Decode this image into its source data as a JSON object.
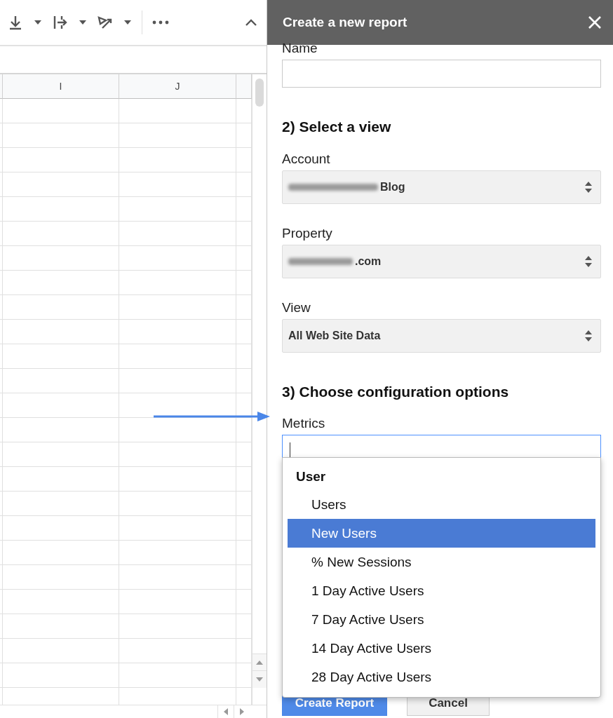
{
  "sheet": {
    "columns": [
      "I",
      "J"
    ]
  },
  "panel": {
    "title": "Create a new report",
    "name_field": {
      "label": "Name"
    },
    "view_section": {
      "heading": "2) Select a view",
      "selects": [
        {
          "label": "Account",
          "value": "Blog",
          "redacted": true
        },
        {
          "label": "Property",
          "value": ".com",
          "redacted": true
        },
        {
          "label": "View",
          "value": "All Web Site Data",
          "redacted": false
        }
      ]
    },
    "config_section": {
      "heading": "3) Choose configuration options",
      "metrics": {
        "label": "Metrics",
        "focused": true,
        "dropdown": {
          "group": "User",
          "options": [
            {
              "label": "Users",
              "selected": false
            },
            {
              "label": "New Users",
              "selected": true
            },
            {
              "label": "% New Sessions",
              "selected": false
            },
            {
              "label": "1 Day Active Users",
              "selected": false
            },
            {
              "label": "7 Day Active Users",
              "selected": false
            },
            {
              "label": "14 Day Active Users",
              "selected": false
            },
            {
              "label": "28 Day Active Users",
              "selected": false
            }
          ]
        }
      }
    },
    "buttons": [
      {
        "label": "Create Report",
        "kind": "primary"
      },
      {
        "label": "Cancel",
        "kind": "secondary"
      }
    ]
  }
}
